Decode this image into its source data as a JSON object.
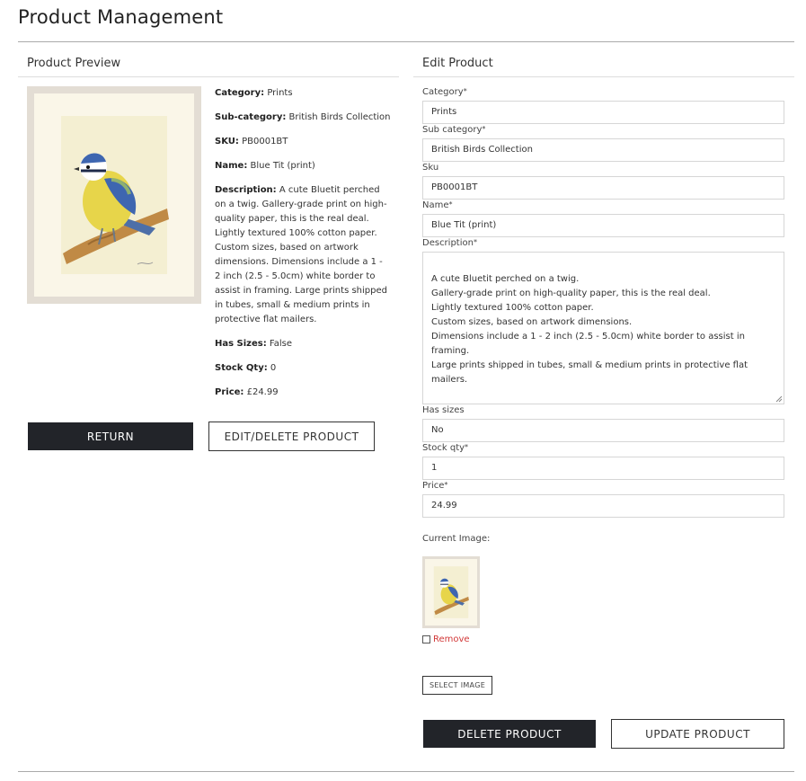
{
  "page": {
    "title": "Product Management"
  },
  "preview": {
    "heading": "Product Preview",
    "image_alt": "Blue Tit print illustration",
    "details": [
      {
        "label": "Category:",
        "value": "Prints"
      },
      {
        "label": "Sub-category:",
        "value": "British Birds Collection"
      },
      {
        "label": "SKU:",
        "value": "PB0001BT"
      },
      {
        "label": "Name:",
        "value": "Blue Tit (print)"
      },
      {
        "label": "Description:",
        "value": "A cute Bluetit perched on a twig. Gallery-grade print on high-quality paper, this is the real deal. Lightly textured 100% cotton paper. Custom sizes, based on artwork dimensions. Dimensions include a 1 - 2 inch (2.5 - 5.0cm) white border to assist in framing. Large prints shipped in tubes, small & medium prints in protective flat mailers."
      },
      {
        "label": "Has Sizes:",
        "value": "False"
      },
      {
        "label": "Stock Qty:",
        "value": "0"
      },
      {
        "label": "Price:",
        "value": "£24.99"
      }
    ],
    "return_label": "RETURN",
    "edit_delete_label": "EDIT/DELETE PRODUCT"
  },
  "edit": {
    "heading": "Edit Product",
    "category": {
      "label": "Category",
      "required": "*",
      "value": "Prints"
    },
    "sub_category": {
      "label": "Sub category",
      "required": "*",
      "value": "British Birds Collection"
    },
    "sku": {
      "label": "Sku",
      "value": "PB0001BT"
    },
    "name": {
      "label": "Name",
      "required": "*",
      "value": "Blue Tit (print)"
    },
    "description": {
      "label": "Description",
      "required": "*",
      "value": "A cute Bluetit perched on a twig.\nGallery-grade print on high-quality paper, this is the real deal.\nLightly textured 100% cotton paper.\nCustom sizes, based on artwork dimensions.\nDimensions include a 1 - 2 inch (2.5 - 5.0cm) white border to assist in framing.\nLarge prints shipped in tubes, small & medium prints in protective flat mailers."
    },
    "has_sizes": {
      "label": "Has sizes",
      "value": "No"
    },
    "stock_qty": {
      "label": "Stock qty",
      "required": "*",
      "value": "1"
    },
    "price": {
      "label": "Price",
      "required": "*",
      "value": "24.99"
    },
    "current_image_label": "Current Image:",
    "remove_label": "Remove",
    "select_image_label": "SELECT IMAGE",
    "delete_label": "DELETE PRODUCT",
    "update_label": "UPDATE PRODUCT"
  },
  "colors": {
    "dark_button": "#222429",
    "remove_red": "#d23838",
    "frame": "#e3ddd4",
    "mat": "#faf6e8"
  },
  "icons": {
    "remove_checkbox": "checkbox-icon",
    "resize": "resize-handle-icon"
  }
}
